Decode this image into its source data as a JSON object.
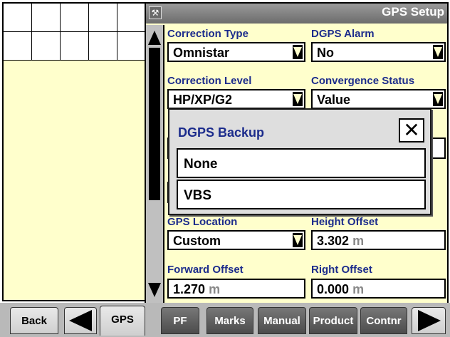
{
  "title": "GPS Setup",
  "fields": {
    "correction_type": {
      "label": "Correction Type",
      "value": "Omnistar"
    },
    "dgps_alarm": {
      "label": "DGPS Alarm",
      "value": "No"
    },
    "correction_level": {
      "label": "Correction Level",
      "value": "HP/XP/G2"
    },
    "convergence_status": {
      "label": "Convergence Status",
      "value": "Value"
    },
    "gps_location": {
      "label": "GPS Location",
      "value": "Custom"
    },
    "height_offset": {
      "label": "Height Offset",
      "value": "3.302",
      "unit": "m"
    },
    "forward_offset": {
      "label": "Forward Offset",
      "value": "1.270",
      "unit": "m"
    },
    "right_offset": {
      "label": "Right Offset",
      "value": "0.000",
      "unit": "m"
    }
  },
  "popup": {
    "title": "DGPS Backup",
    "close": "✕",
    "options": [
      "None",
      "VBS"
    ]
  },
  "tabs": {
    "back": "Back",
    "gps": "GPS",
    "pf": "PF",
    "marks": "Marks",
    "manual": "Manual",
    "product": "Product",
    "contnr": "Contnr"
  }
}
